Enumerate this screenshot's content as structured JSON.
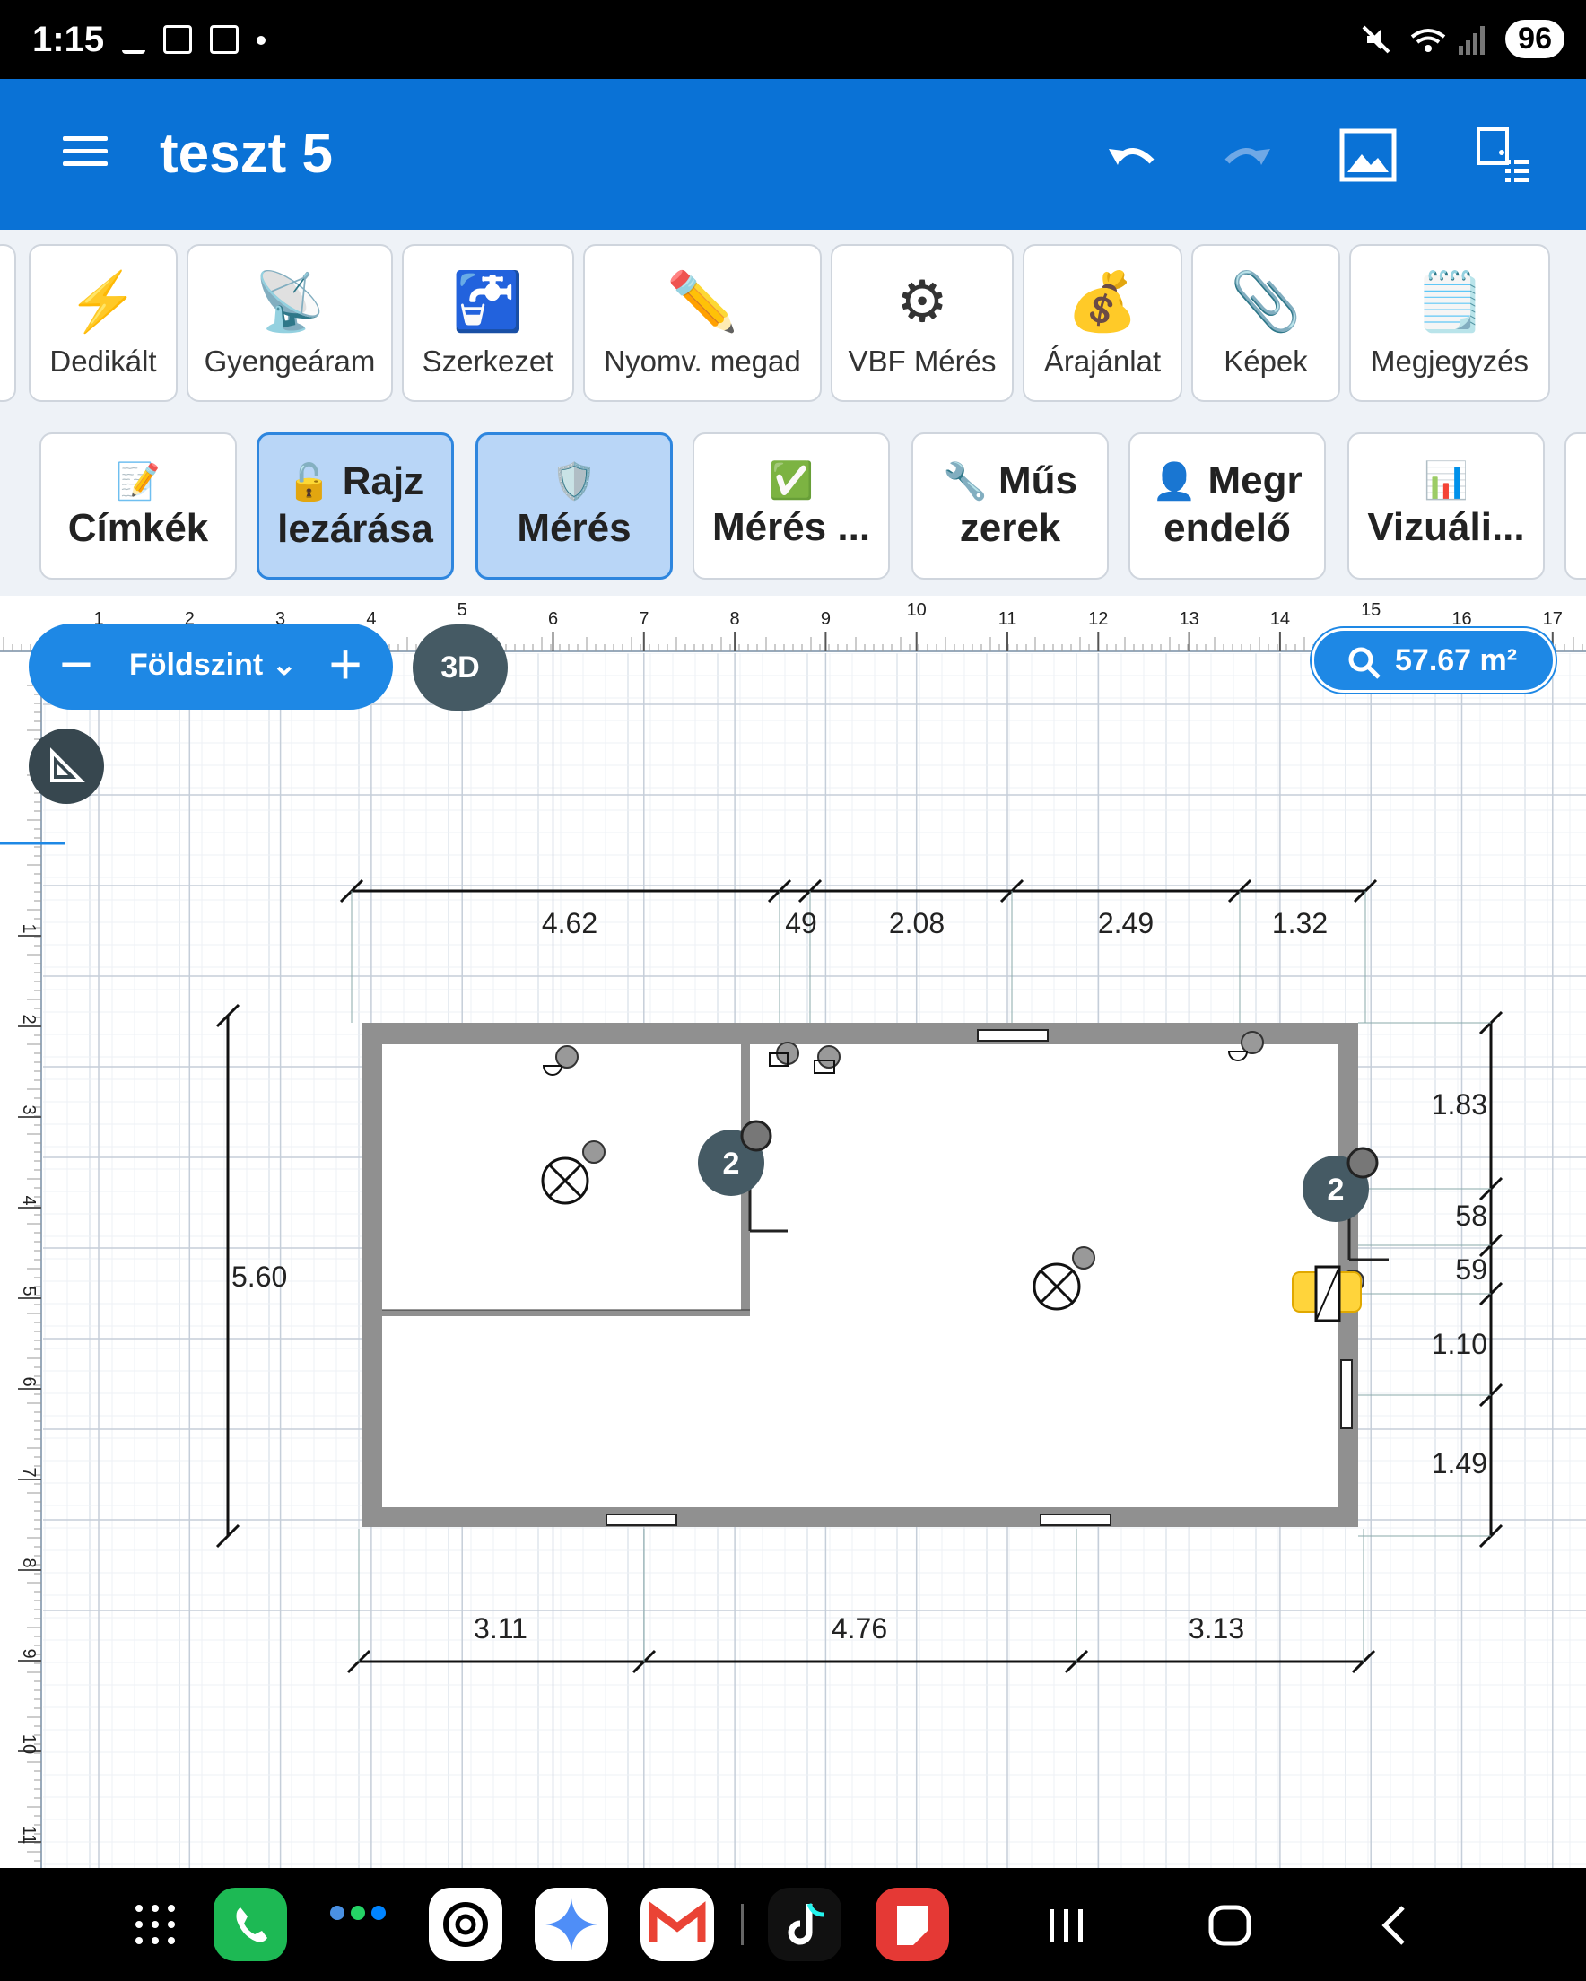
{
  "status": {
    "time": "1:15",
    "battery": "96"
  },
  "app": {
    "title": "teszt 5"
  },
  "toolbar_row1": [
    {
      "label": "Dedikált",
      "icon": "lightning-icon"
    },
    {
      "label": "Gyengeáram",
      "icon": "satellite-dish-icon"
    },
    {
      "label": "Szerkezet",
      "icon": "water-tap-icon"
    },
    {
      "label": "Nyomv. megad",
      "icon": "pencil-icon"
    },
    {
      "label": "VBF Mérés",
      "icon": "gear-icon"
    },
    {
      "label": "Árajánlat",
      "icon": "money-bag-icon"
    },
    {
      "label": "Képek",
      "icon": "paperclip-icon"
    },
    {
      "label": "Megjegyzés",
      "icon": "notepad-icon"
    }
  ],
  "toolbar_row2": [
    {
      "label": "Címkék",
      "icon": "memo-icon",
      "active": false
    },
    {
      "label": "Rajz lezárása",
      "icon": "lock-icon",
      "active": true
    },
    {
      "label": "Mérés",
      "icon": "shield-icon",
      "active": true
    },
    {
      "label": "Mérés ...",
      "icon": "checkmark-icon",
      "active": false
    },
    {
      "label": "Műs zerek",
      "icon": "wrench-icon",
      "active": false
    },
    {
      "label": "Megr endelő",
      "icon": "person-icon",
      "active": false
    },
    {
      "label": "Vizuáli...",
      "icon": "bar-chart-icon",
      "active": false
    }
  ],
  "canvas": {
    "level": "Földszint",
    "btn_3d": "3D",
    "area": "57.67 m²",
    "ruler_top": [
      "1",
      "2",
      "3",
      "4",
      "5",
      "6",
      "7",
      "8",
      "9",
      "10",
      "11",
      "12",
      "13",
      "14",
      "15",
      "16",
      "17"
    ],
    "ruler_left": [
      "1",
      "2",
      "3",
      "4",
      "5",
      "6",
      "7",
      "8",
      "9",
      "10",
      "11"
    ],
    "dims_top": [
      "4.62",
      "49",
      "2.08",
      "2.49",
      "1.32"
    ],
    "dims_left": [
      "5.60"
    ],
    "dims_right": [
      "1.83",
      "58",
      "59",
      "1.10",
      "1.49"
    ],
    "dims_bottom": [
      "3.11",
      "4.76",
      "3.13"
    ],
    "badges": [
      "2",
      "2"
    ]
  }
}
